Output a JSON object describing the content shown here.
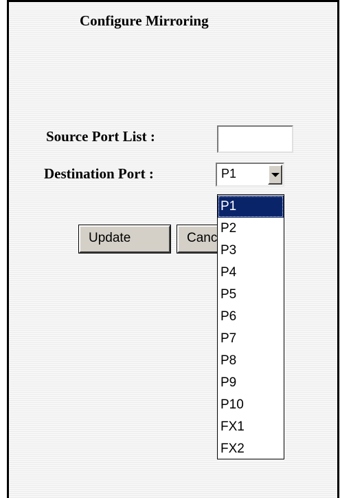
{
  "page": {
    "title": "Configure Mirroring"
  },
  "form": {
    "source_label": "Source Port List :",
    "source_value": "",
    "dest_label": "Destination Port :",
    "dest_selected": "P1"
  },
  "buttons": {
    "update_label": "Update",
    "cancel_label": "Cancel"
  },
  "dropdown": {
    "options": [
      "P1",
      "P2",
      "P3",
      "P4",
      "P5",
      "P6",
      "P7",
      "P8",
      "P9",
      "P10",
      "FX1",
      "FX2"
    ],
    "selected_index": 0
  },
  "colors": {
    "selection_bg": "#0a246a",
    "button_face": "#d4d0c8"
  },
  "icons": {
    "select_arrow": "chevron-down-icon"
  }
}
